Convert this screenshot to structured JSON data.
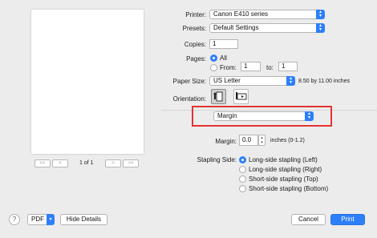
{
  "preview": {
    "page_indicator": "1 of 1",
    "first_label": "<<",
    "prev_label": "<",
    "next_label": ">",
    "last_label": ">>"
  },
  "printer": {
    "label": "Printer:",
    "value": "Canon E410 series"
  },
  "presets": {
    "label": "Presets:",
    "value": "Default Settings"
  },
  "copies": {
    "label": "Copies:",
    "value": "1"
  },
  "pages": {
    "label": "Pages:",
    "all_label": "All",
    "from_label": "From:",
    "from_value": "1",
    "to_label": "to:",
    "to_value": "1",
    "selected": "All"
  },
  "paper_size": {
    "label": "Paper Size:",
    "value": "US Letter",
    "dimensions": "8.50 by 11.00 inches"
  },
  "orientation": {
    "label": "Orientation:",
    "selected": "portrait"
  },
  "section_popup": {
    "value": "Margin"
  },
  "margin": {
    "label": "Margin:",
    "value": "0.0",
    "unit": "inches (0-1.2)"
  },
  "stapling": {
    "label": "Stapling Side:",
    "options": [
      "Long-side stapling (Left)",
      "Long-side stapling (Right)",
      "Short-side stapling (Top)",
      "Short-side stapling (Bottom)"
    ],
    "selected": "Long-side stapling (Left)"
  },
  "footer": {
    "help_label": "?",
    "pdf_label": "PDF",
    "hide_details_label": "Hide Details",
    "cancel_label": "Cancel",
    "print_label": "Print"
  },
  "colors": {
    "accent": "#2d7ff9",
    "highlight": "#e53333"
  }
}
